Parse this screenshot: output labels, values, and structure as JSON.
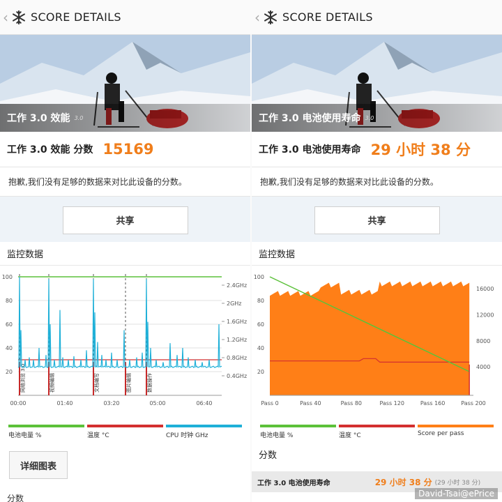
{
  "left": {
    "topbar": {
      "title": "SCORE DETAILS"
    },
    "hero": {
      "name": "工作 3.0 效能",
      "version": "3.0"
    },
    "score": {
      "label": "工作 3.0 效能 分数",
      "value": "15169"
    },
    "note": "抱歉,我们没有足够的数据来对比此设备的分数。",
    "share_label": "共享",
    "monitor_title": "监控数据",
    "detail_button": "详细图表",
    "cut_label": "分数",
    "legend": [
      "电池电量 %",
      "温度 °C",
      "CPU 时钟 GHz"
    ],
    "chart_data": {
      "type": "line",
      "title": "",
      "x_ticks": [
        "00:00",
        "01:40",
        "03:20",
        "05:00",
        "06:40"
      ],
      "y_left_ticks": [
        "100",
        "80",
        "60",
        "40",
        "20"
      ],
      "y_right_ticks": [
        "2.4GHz",
        "2GHz",
        "1.6GHz",
        "1.2GHz",
        "0.8GHz",
        "0.4GHz"
      ],
      "markers": [
        "网络浏览 3.0",
        "视频编辑",
        "文档编写",
        "图片编辑",
        "数据操作"
      ],
      "series": [
        {
          "name": "电池电量 %",
          "color": "#5cc13a",
          "note": "flat near 100"
        },
        {
          "name": "温度 °C",
          "color": "#d32f2f",
          "note": "flat near 29"
        },
        {
          "name": "CPU 时钟 GHz",
          "color": "#1fb0d8",
          "note": "spiky, baseline ~0.6GHz, peaks ~2.4GHz"
        }
      ],
      "ylim": [
        0,
        100
      ]
    }
  },
  "right": {
    "topbar": {
      "title": "SCORE DETAILS"
    },
    "hero": {
      "name": "工作 3.0 电池使用寿命",
      "version": "3.0"
    },
    "score": {
      "label": "工作 3.0 电池使用寿命",
      "value": "29 小时 38 分"
    },
    "note": "抱歉,我们没有足够的数据来对比此设备的分数。",
    "share_label": "共享",
    "monitor_title": "监控数据",
    "legend": [
      "电池电量 %",
      "温度 °C",
      "Score per pass"
    ],
    "score_section": "分数",
    "score_row": {
      "label": "工作 3.0 电池使用寿命",
      "value": "29 小时 38 分",
      "paren": "(29 小时 38 分)"
    },
    "chart_data": {
      "type": "area",
      "title": "",
      "x_ticks": [
        "Pass 0",
        "Pass 40",
        "Pass 80",
        "Pass 120",
        "Pass 160",
        "Pass 200"
      ],
      "y_left_ticks": [
        "100",
        "80",
        "60",
        "40",
        "20"
      ],
      "y_right_ticks": [
        "16000",
        "12000",
        "8000",
        "4000"
      ],
      "series": [
        {
          "name": "Score per pass",
          "color": "#ff7f17"
        },
        {
          "name": "电池电量 %",
          "color": "#5cc13a",
          "x": [
            0,
            196
          ],
          "y": [
            100,
            20
          ]
        },
        {
          "name": "温度 °C",
          "color": "#d32f2f"
        }
      ],
      "ylim": [
        0,
        100
      ]
    }
  },
  "watermark": "David-Tsai@ePrice",
  "colors": {
    "accent": "#f07e1b",
    "battery": "#5cc13a",
    "temp": "#d32f2f",
    "cpu": "#1fb0d8",
    "score": "#ff7f17"
  }
}
